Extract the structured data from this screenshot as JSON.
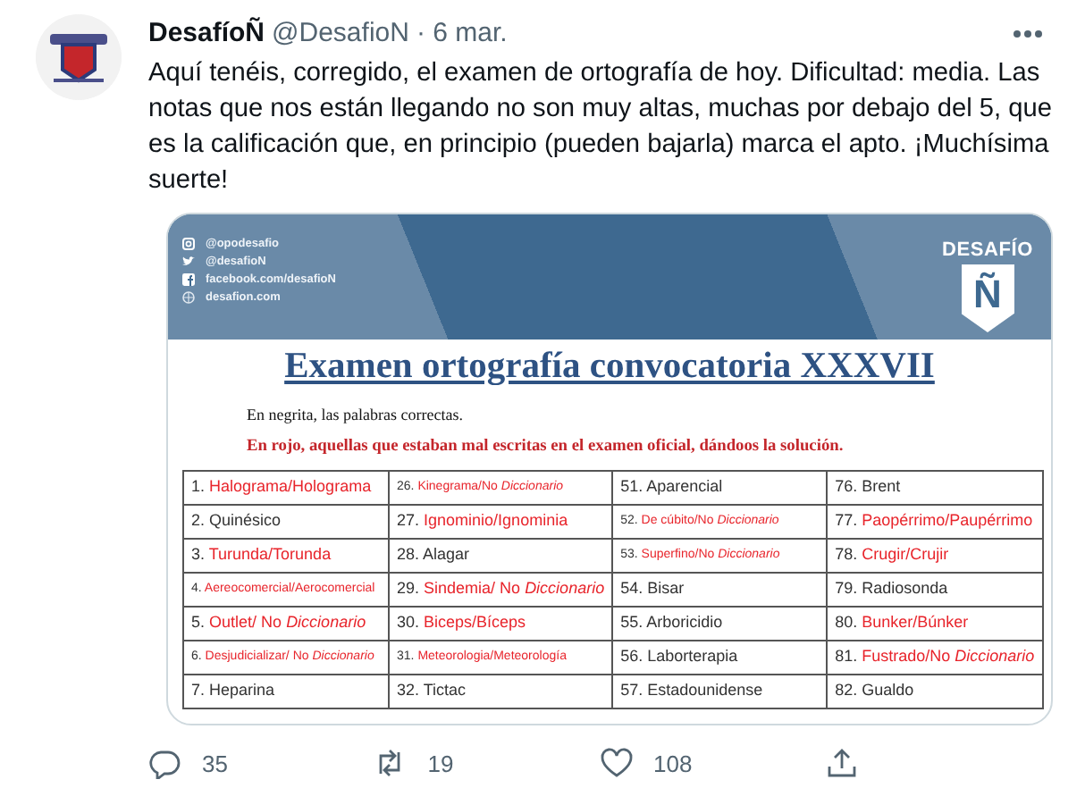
{
  "tweet": {
    "author": "DesafíoÑ",
    "handle": "@DesafioN",
    "date": "· 6 mar.",
    "text": "Aquí tenéis, corregido, el examen de ortografía de hoy. Dificultad: media. Las notas que nos están llegando no son muy altas, muchas por debajo del 5, que es la calificación que, en principio (pueden bajarla) marca el apto. ¡Muchísima suerte!"
  },
  "document": {
    "socials": [
      {
        "kind": "instagram",
        "text": "@opodesafio"
      },
      {
        "kind": "twitter",
        "text": "@desafioN"
      },
      {
        "kind": "facebook",
        "text": "facebook.com/desafioN"
      },
      {
        "kind": "web",
        "text": "desafion.com"
      }
    ],
    "logo": {
      "name": "DESAFÍO",
      "letter": "Ñ"
    },
    "title": "Examen ortografía convocatoria XXXVII",
    "note": "En negrita, las palabras correctas.",
    "red_note": "En rojo, aquellas que estaban mal escritas en el examen oficial, dándoos la solución.",
    "table": {
      "rows": [
        [
          {
            "number": "1.",
            "text": "Halograma/Holograma",
            "corrected": true,
            "compact": false
          },
          {
            "number": "26.",
            "text": "Kinegrama/No *Diccionario*",
            "corrected": true,
            "compact": true
          },
          {
            "number": "51.",
            "text": "Aparencial",
            "corrected": false,
            "compact": false
          },
          {
            "number": "76.",
            "text": "Brent",
            "corrected": false,
            "compact": false
          }
        ],
        [
          {
            "number": "2.",
            "text": "Quinésico",
            "corrected": false,
            "compact": false
          },
          {
            "number": "27.",
            "text": "Ignominio/Ignominia",
            "corrected": true,
            "compact": false
          },
          {
            "number": "52.",
            "text": "De cúbito/No *Diccionario*",
            "corrected": true,
            "compact": true
          },
          {
            "number": "77.",
            "text": "Paopérrimo/Paupérrimo",
            "corrected": true,
            "compact": false
          }
        ],
        [
          {
            "number": "3.",
            "text": "Turunda/Torunda",
            "corrected": true,
            "compact": false
          },
          {
            "number": "28.",
            "text": "Alagar",
            "corrected": false,
            "compact": false
          },
          {
            "number": "53.",
            "text": "Superfino/No *Diccionario*",
            "corrected": true,
            "compact": true
          },
          {
            "number": "78.",
            "text": "Crugir/Crujir",
            "corrected": true,
            "compact": false
          }
        ],
        [
          {
            "number": "4.",
            "text": "Aereocomercial/Aerocomercial",
            "corrected": true,
            "compact": true
          },
          {
            "number": "29.",
            "text": "Sindemia/ No *Diccionario*",
            "corrected": true,
            "compact": false
          },
          {
            "number": "54.",
            "text": "Bisar",
            "corrected": false,
            "compact": false
          },
          {
            "number": "79.",
            "text": "Radiosonda",
            "corrected": false,
            "compact": false
          }
        ],
        [
          {
            "number": "5.",
            "text": "Outlet/ No *Diccionario*",
            "corrected": true,
            "compact": false
          },
          {
            "number": "30.",
            "text": "Biceps/Bíceps",
            "corrected": true,
            "compact": false
          },
          {
            "number": "55.",
            "text": "Arboricidio",
            "corrected": false,
            "compact": false
          },
          {
            "number": "80.",
            "text": "Bunker/Búnker",
            "corrected": true,
            "compact": false
          }
        ],
        [
          {
            "number": "6.",
            "text": "Desjudicializar/ No *Diccionario*",
            "corrected": true,
            "compact": true
          },
          {
            "number": "31.",
            "text": "Meteorologia/Meteorología",
            "corrected": true,
            "compact": true
          },
          {
            "number": "56.",
            "text": "Laborterapia",
            "corrected": false,
            "compact": false
          },
          {
            "number": "81.",
            "text": "Fustrado/No *Diccionario*",
            "corrected": true,
            "compact": false
          }
        ],
        [
          {
            "number": "7.",
            "text": "Heparina",
            "corrected": false,
            "compact": false
          },
          {
            "number": "32.",
            "text": "Tictac",
            "corrected": false,
            "compact": false
          },
          {
            "number": "57.",
            "text": "Estadounidense",
            "corrected": false,
            "compact": false
          },
          {
            "number": "82.",
            "text": "Gualdo",
            "corrected": false,
            "compact": false
          }
        ]
      ]
    }
  },
  "actions": [
    {
      "kind": "reply",
      "count": "35"
    },
    {
      "kind": "retweet",
      "count": "19"
    },
    {
      "kind": "like",
      "count": "108"
    },
    {
      "kind": "share"
    }
  ]
}
